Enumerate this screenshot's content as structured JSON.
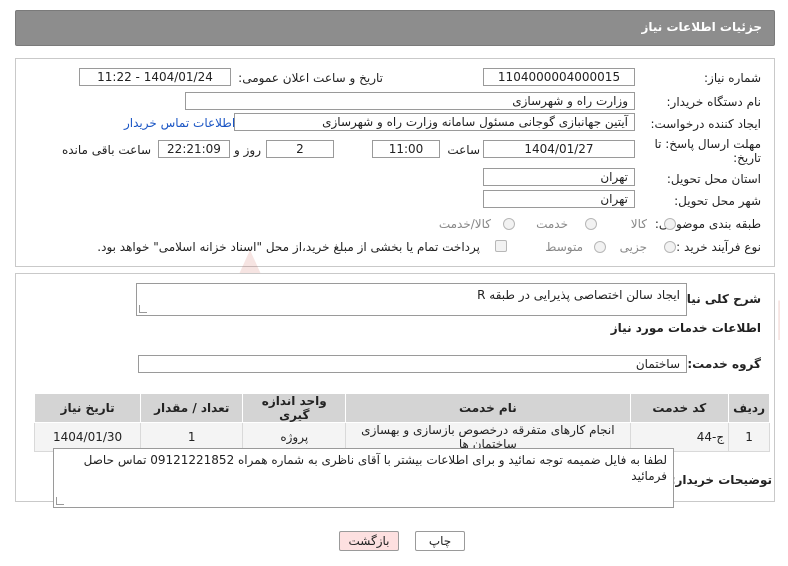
{
  "header": {
    "title": "جزئیات اطلاعات نیاز"
  },
  "form": {
    "need_number_label": "شماره نیاز:",
    "need_number": "1104000004000015",
    "announce_label": "تاریخ و ساعت اعلان عمومی:",
    "announce_value": "1404/01/24 - 11:22",
    "buyer_org_label": "نام دستگاه خریدار:",
    "buyer_org": "وزارت راه و شهرسازی",
    "creator_label": "ایجاد کننده درخواست:",
    "creator": "آیتین جهانبازی گوجانی مسئول سامانه وزارت راه و شهرسازی",
    "buyer_contact_link": "اطلاعات تماس خریدار",
    "deadline_label_1": "مهلت ارسال پاسخ: تا",
    "deadline_label_2": "تاریخ:",
    "deadline_date": "1404/01/27",
    "time_label": "ساعت",
    "deadline_time": "11:00",
    "days_value": "2",
    "days_label": "روز و",
    "remaining_time": "22:21:09",
    "remaining_label": "ساعت باقی مانده",
    "province_label": "استان محل تحویل:",
    "province": "تهران",
    "city_label": "شهر محل تحویل:",
    "city": "تهران",
    "category_label": "طبقه بندی موضوعی:",
    "category_options": [
      "کالا",
      "خدمت",
      "کالا/خدمت"
    ],
    "purchase_type_label": "نوع فرآیند خرید :",
    "purchase_type_options": [
      "جزیی",
      "متوسط"
    ],
    "payment_note": "پرداخت تمام یا بخشی از مبلغ خرید،از محل \"اسناد خزانه اسلامی\" خواهد بود."
  },
  "need": {
    "summary_label": "شرح کلی نیاز:",
    "summary": "ایجاد سالن اختصاصی پذیرایی در طبقه R",
    "services_title": "اطلاعات خدمات مورد نیاز",
    "service_group_label": "گروه خدمت:",
    "service_group": "ساختمان"
  },
  "table": {
    "headers": [
      "ردیف",
      "کد خدمت",
      "نام خدمت",
      "واحد اندازه گیری",
      "تعداد / مقدار",
      "تاریخ نیاز"
    ],
    "rows": [
      [
        "1",
        "ج-44",
        "انجام کارهای متفرقه درخصوص بازسازی و بهسازی ساختمان ها",
        "پروژه",
        "1",
        "1404/01/30"
      ]
    ]
  },
  "notes": {
    "label": "توضیحات خریدار:",
    "text": "لطفا به فایل ضمیمه توجه نمائید و برای اطلاعات بیشتر با آقای ناظری به شماره همراه  09121221852 تماس حاصل فرمائید"
  },
  "buttons": {
    "print": "چاپ",
    "back": "بازگشت"
  },
  "watermark": {
    "brand": "AriaTender.neT"
  },
  "colors": {
    "header_bg": "#8d8d8d",
    "link": "#1a55c4",
    "back_button_bg": "#fde0e0",
    "watermark": "#c0392b"
  }
}
